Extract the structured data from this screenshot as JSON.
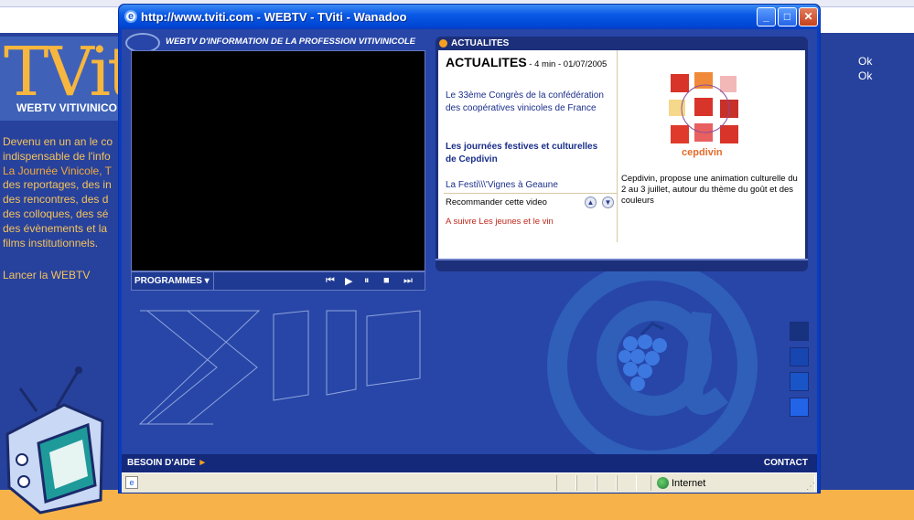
{
  "background": {
    "logo_text": "TVi",
    "logo_suffix": "ti",
    "logo_subtitle": "WEBTV VITIVINICO",
    "intro_lines": [
      "Devenu en un an le co",
      "indispensable de l'info",
      "La Journée Vinicole, T",
      "des reportages, des in",
      "des rencontres, des d",
      "des colloques, des sé",
      "des évènements et la",
      "films institutionnels."
    ],
    "launch_link": "Lancer la WEBTV",
    "ok_1": "Ok",
    "ok_2": "Ok"
  },
  "window": {
    "title": "http://www.tviti.com - WEBTV - TViti - Wanadoo",
    "minimize": "_",
    "maximize": "□",
    "close": "✕"
  },
  "player": {
    "header": "WEBTV D'INFORMATION DE LA PROFESSION VITIVINICOLE",
    "programmes_label": "PROGRAMMES ▾",
    "controls": [
      "prev-icon",
      "play-icon",
      "pause-icon",
      "stop-icon",
      "next-icon"
    ]
  },
  "news": {
    "header": "ACTUALITES",
    "heading": "ACTUALITES",
    "meta": " - 4 min - 01/07/2005",
    "items": [
      "Le 33ème Congrès de la confédération des coopératives vinicoles de France",
      "Les journées festives et culturelles de Cepdivin",
      "La Festi\\\\\\'Vignes à Geaune"
    ],
    "recommend": "Recommander cette video",
    "next_up": "A suivre Les jeunes et le vin",
    "image_label": "cepdivin",
    "description": "Cepdivin, propose une animation culturelle du 2 au 3 juillet, autour du thème du goût et des couleurs"
  },
  "footer": {
    "help": "BESOIN D'AIDE",
    "help_arrow": "►",
    "contact": "CONTACT"
  },
  "statusbar": {
    "zone": "Internet"
  },
  "colors": {
    "accent_orange": "#f7b34a",
    "window_blue": "#0a3cc0",
    "panel_navy": "#1c2f7b"
  }
}
